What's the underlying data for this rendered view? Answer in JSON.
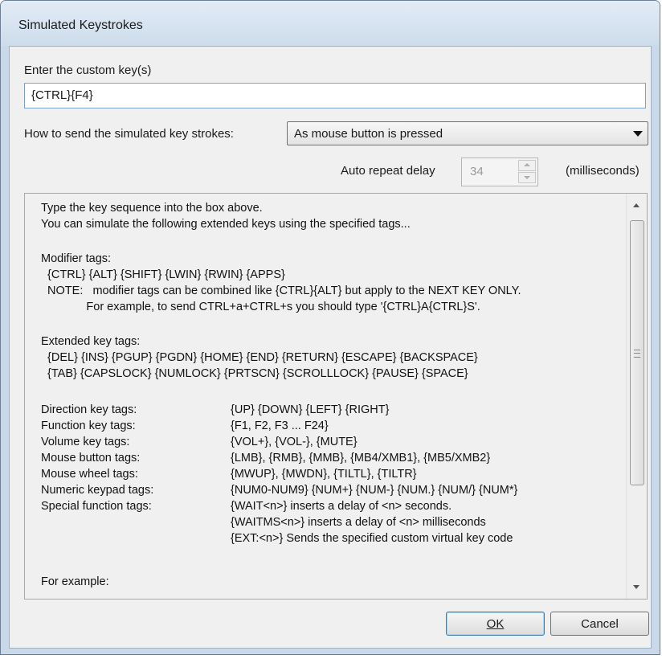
{
  "window": {
    "title": "Simulated Keystrokes"
  },
  "custom_keys": {
    "label": "Enter the custom key(s)",
    "value": "{CTRL}{F4}"
  },
  "send_mode": {
    "label": "How to send the simulated key strokes:",
    "selected": "As mouse button is pressed"
  },
  "auto_repeat": {
    "label": "Auto repeat delay",
    "value": "34",
    "unit": "(milliseconds)"
  },
  "help": {
    "lines": [
      "Type the key sequence into the box above.",
      "You can simulate the following extended keys using the specified tags...",
      "Modifier tags:",
      "  {CTRL} {ALT} {SHIFT} {LWIN} {RWIN} {APPS}",
      "  NOTE:   modifier tags can be combined like {CTRL}{ALT} but apply to the NEXT KEY ONLY.",
      "              For example, to send CTRL+a+CTRL+s you should type '{CTRL}A{CTRL}S'.",
      "Extended key tags:",
      "  {DEL} {INS} {PGUP} {PGDN} {HOME} {END} {RETURN} {ESCAPE} {BACKSPACE}",
      "  {TAB} {CAPSLOCK} {NUMLOCK} {PRTSCN} {SCROLLLOCK} {PAUSE} {SPACE}"
    ],
    "tag_table": [
      {
        "label": "Direction key tags:",
        "value": "{UP} {DOWN} {LEFT} {RIGHT}"
      },
      {
        "label": "Function key tags:",
        "value": "{F1, F2, F3 ... F24}"
      },
      {
        "label": "Volume key tags:",
        "value": "{VOL+}, {VOL-}, {MUTE}"
      },
      {
        "label": "Mouse button tags:",
        "value": "{LMB}, {RMB}, {MMB}, {MB4/XMB1}, {MB5/XMB2}"
      },
      {
        "label": "Mouse wheel tags:",
        "value": "{MWUP}, {MWDN}, {TILTL}, {TILTR}"
      },
      {
        "label": "Numeric keypad tags:",
        "value": "{NUM0-NUM9} {NUM+} {NUM-} {NUM.} {NUM/} {NUM*}"
      },
      {
        "label": "Special function tags:",
        "value": "{WAIT<n>} inserts a delay of <n> seconds."
      },
      {
        "label": "",
        "value": "{WAITMS<n>} inserts a delay of <n> milliseconds"
      },
      {
        "label": "",
        "value": "{EXT:<n>} Sends the specified custom virtual key code"
      }
    ],
    "footer": "For example:"
  },
  "buttons": {
    "ok": "OK",
    "cancel": "Cancel"
  }
}
